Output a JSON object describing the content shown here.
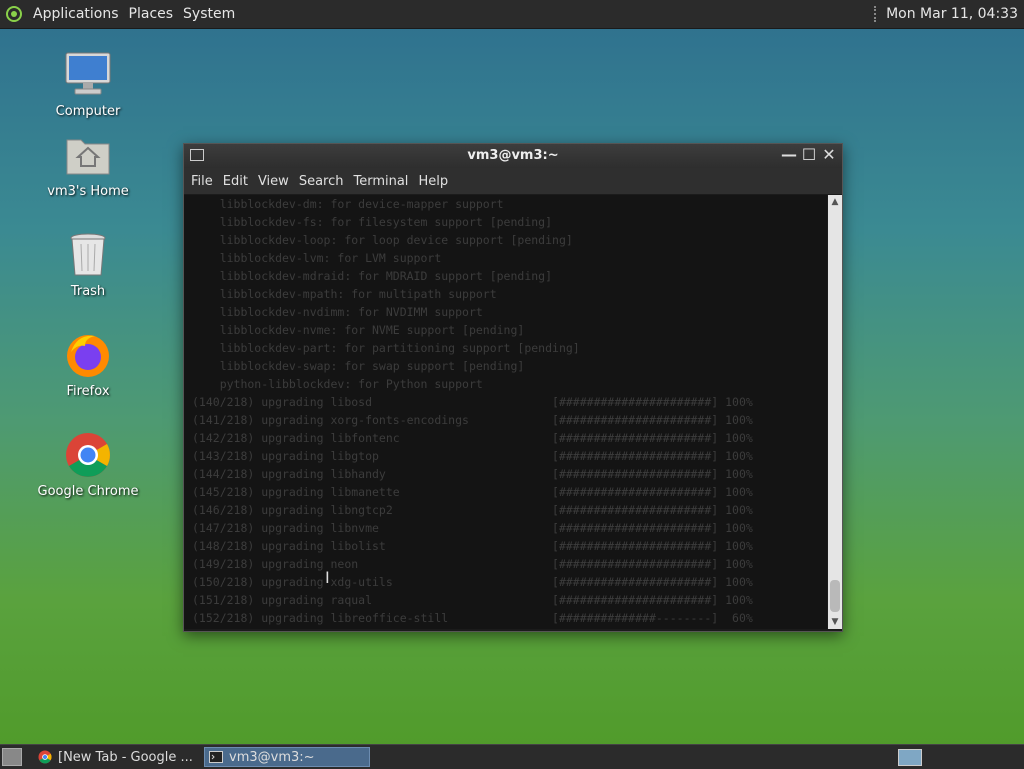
{
  "top_panel": {
    "menus": [
      "Applications",
      "Places",
      "System"
    ],
    "clock": "Mon Mar 11, 04:33"
  },
  "desktop_icons": [
    {
      "label": "Computer",
      "icon": "computer-icon"
    },
    {
      "label": "vm3's Home",
      "icon": "home-folder-icon"
    },
    {
      "label": "Trash",
      "icon": "trash-icon"
    },
    {
      "label": "Firefox",
      "icon": "firefox-icon"
    },
    {
      "label": "Google Chrome",
      "icon": "chrome-icon"
    }
  ],
  "terminal": {
    "title": "vm3@vm3:~",
    "menu": [
      "File",
      "Edit",
      "View",
      "Search",
      "Terminal",
      "Help"
    ],
    "lines": [
      "    libblockdev-dm: for device-mapper support",
      "    libblockdev-fs: for filesystem support [pending]",
      "    libblockdev-loop: for loop device support [pending]",
      "    libblockdev-lvm: for LVM support",
      "    libblockdev-mdraid: for MDRAID support [pending]",
      "    libblockdev-mpath: for multipath support",
      "    libblockdev-nvdimm: for NVDIMM support",
      "    libblockdev-nvme: for NVME support [pending]",
      "    libblockdev-part: for partitioning support [pending]",
      "    libblockdev-swap: for swap support [pending]",
      "    python-libblockdev: for Python support",
      "(140/218) upgrading libosd                          [######################] 100%",
      "(141/218) upgrading xorg-fonts-encodings            [######################] 100%",
      "(142/218) upgrading libfontenc                      [######################] 100%",
      "(143/218) upgrading libgtop                         [######################] 100%",
      "(144/218) upgrading libhandy                        [######################] 100%",
      "(145/218) upgrading libmanette                      [######################] 100%",
      "(146/218) upgrading libngtcp2                       [######################] 100%",
      "(147/218) upgrading libnvme                         [######################] 100%",
      "(148/218) upgrading libolist                        [######################] 100%",
      "(149/218) upgrading neon                            [######################] 100%",
      "(150/218) upgrading xdg-utils                       [######################] 100%",
      "(151/218) upgrading raqual                          [######################] 100%",
      "(152/218) upgrading libreoffice-still               [##############--------]  60%"
    ]
  },
  "taskbar": {
    "tasks": [
      {
        "label": "[New Tab - Google ...",
        "icon": "chrome-icon"
      },
      {
        "label": "vm3@vm3:~",
        "icon": "terminal-icon"
      }
    ]
  }
}
